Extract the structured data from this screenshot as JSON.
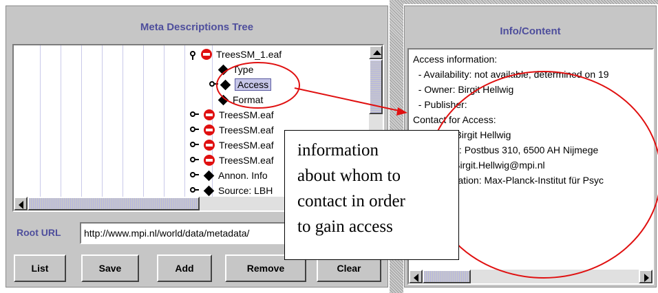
{
  "left_panel": {
    "title": "Meta Descriptions Tree",
    "tree": [
      {
        "label": "TreesSM_1.eaf",
        "icon": "red-no-entry",
        "depth": 0,
        "expanded": true
      },
      {
        "label": "Type",
        "icon": "diamond",
        "depth": 1
      },
      {
        "label": "Access",
        "icon": "diamond",
        "depth": 1,
        "selected": true
      },
      {
        "label": "Format",
        "icon": "diamond",
        "depth": 1
      },
      {
        "label": "TreesSM.eaf",
        "icon": "red-no-entry",
        "depth": 0
      },
      {
        "label": "TreesSM.eaf",
        "icon": "red-no-entry",
        "depth": 0
      },
      {
        "label": "TreesSM.eaf",
        "icon": "red-no-entry",
        "depth": 0
      },
      {
        "label": "TreesSM.eaf",
        "icon": "red-no-entry",
        "depth": 0
      },
      {
        "label": "Annon. Info",
        "icon": "diamond",
        "depth": 0
      },
      {
        "label": "Source: LBH",
        "icon": "diamond",
        "depth": 0
      }
    ],
    "root_url_label": "Root URL",
    "root_url_value": "http://www.mpi.nl/world/data/metadata/",
    "buttons": {
      "list": "List",
      "save": "Save",
      "add": "Add",
      "remove": "Remove",
      "clear": "Clear"
    }
  },
  "right_panel": {
    "title": "Info/Content",
    "lines": [
      "Access information:",
      "  - Availability: not available, determined on 19",
      "  - Owner: Birgit Hellwig",
      "  - Publisher:",
      "Contact for Access:",
      "  - Name: Birgit Hellwig",
      "  - Address: Postbus 310, 6500 AH Nijmege",
      "  - Email: Birgit.Hellwig@mpi.nl",
      "  - Organisation: Max-Planck-Institut für Psyc"
    ]
  },
  "callout": {
    "lines": [
      "information",
      "about whom to",
      "contact in order",
      "to gain access"
    ]
  },
  "colors": {
    "panel_bg": "#c6c6c6",
    "title_text": "#4e4e9c",
    "annotation_red": "#e01010",
    "selection_bg": "#c6c6e8"
  }
}
